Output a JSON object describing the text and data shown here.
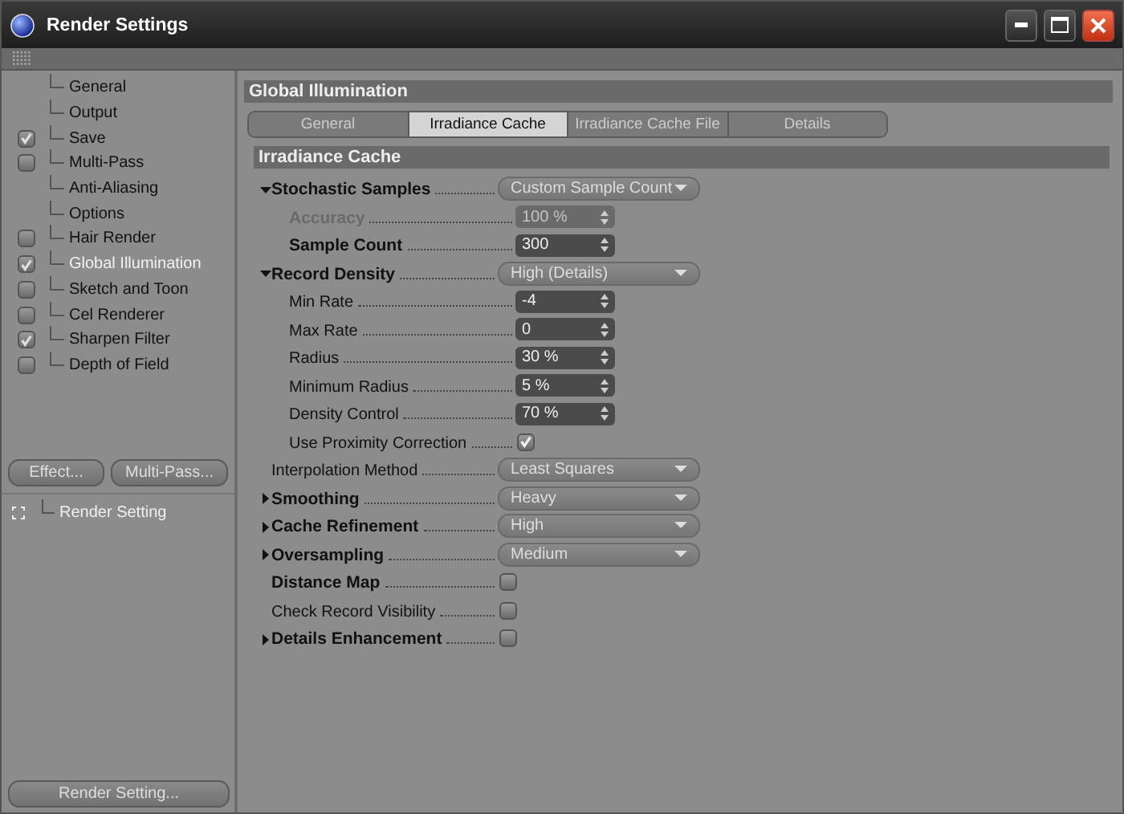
{
  "window": {
    "title": "Render Settings"
  },
  "sidebar": {
    "items": [
      {
        "label": "General",
        "selected": false
      },
      {
        "label": "Output",
        "selected": false
      },
      {
        "label": "Save",
        "checked": true,
        "selected": false
      },
      {
        "label": "Multi-Pass",
        "checked": false,
        "selected": false
      },
      {
        "label": "Anti-Aliasing",
        "selected": false
      },
      {
        "label": "Options",
        "selected": false
      },
      {
        "label": "Hair Render",
        "checked": false,
        "selected": false
      },
      {
        "label": "Global Illumination",
        "checked": true,
        "selected": true
      },
      {
        "label": "Sketch and Toon",
        "checked": false,
        "selected": false
      },
      {
        "label": "Cel Renderer",
        "checked": false,
        "selected": false
      },
      {
        "label": "Sharpen Filter",
        "checked": true,
        "selected": false
      },
      {
        "label": "Depth of Field",
        "checked": false,
        "selected": false
      }
    ],
    "buttons": [
      "Effect...",
      "Multi-Pass..."
    ],
    "settings": [
      {
        "label": "Render Setting"
      }
    ],
    "bottom_button": "Render Setting..."
  },
  "panel": {
    "title": "Global Illumination",
    "tabs": [
      {
        "label": "General",
        "selected": false
      },
      {
        "label": "Irradiance Cache",
        "selected": true
      },
      {
        "label": "Irradiance Cache File",
        "selected": false
      },
      {
        "label": "Details",
        "selected": false
      }
    ],
    "section": "Irradiance Cache",
    "params": [
      {
        "label": "Stochastic Samples",
        "kind": "dropdown",
        "value": "Custom Sample Count",
        "bold": true,
        "expanded": true,
        "disabled": false,
        "children": [
          {
            "label": "Accuracy",
            "kind": "number",
            "value": "100 %",
            "bold": true,
            "disabled": true
          },
          {
            "label": "Sample Count",
            "kind": "number",
            "value": "300",
            "bold": true,
            "disabled": false
          }
        ]
      },
      {
        "label": "Record Density",
        "kind": "dropdown",
        "value": "High (Details)",
        "bold": true,
        "expanded": true,
        "disabled": false,
        "children": [
          {
            "label": "Min Rate",
            "kind": "number",
            "value": "-4",
            "bold": false,
            "disabled": false
          },
          {
            "label": "Max Rate",
            "kind": "number",
            "value": "0",
            "bold": false,
            "disabled": false
          },
          {
            "label": "Radius",
            "kind": "number",
            "value": "30 %",
            "bold": false,
            "disabled": false
          },
          {
            "label": "Minimum Radius",
            "kind": "number",
            "value": "5 %",
            "bold": false,
            "disabled": false
          },
          {
            "label": "Density Control",
            "kind": "number",
            "value": "70 %",
            "bold": false,
            "disabled": false
          },
          {
            "label": "Use Proximity Correction",
            "kind": "checkbox",
            "checked": true,
            "bold": false,
            "disabled": false
          }
        ]
      },
      {
        "label": "Interpolation Method",
        "kind": "dropdown",
        "value": "Least Squares",
        "bold": false,
        "disabled": false
      },
      {
        "label": "Smoothing",
        "kind": "dropdown",
        "value": "Heavy",
        "bold": true,
        "expanded": false,
        "disabled": false
      },
      {
        "label": "Cache Refinement",
        "kind": "dropdown",
        "value": "High",
        "bold": true,
        "expanded": false,
        "disabled": false
      },
      {
        "label": "Oversampling",
        "kind": "dropdown",
        "value": "Medium",
        "bold": true,
        "expanded": false,
        "disabled": false
      },
      {
        "label": "Distance Map",
        "kind": "checkbox",
        "checked": false,
        "bold": true,
        "disabled": false
      },
      {
        "label": "Check Record Visibility",
        "kind": "checkbox",
        "checked": false,
        "bold": false,
        "disabled": false
      },
      {
        "label": "Details Enhancement",
        "kind": "checkbox",
        "checked": false,
        "bold": true,
        "expanded": false,
        "disabled": false
      }
    ]
  }
}
